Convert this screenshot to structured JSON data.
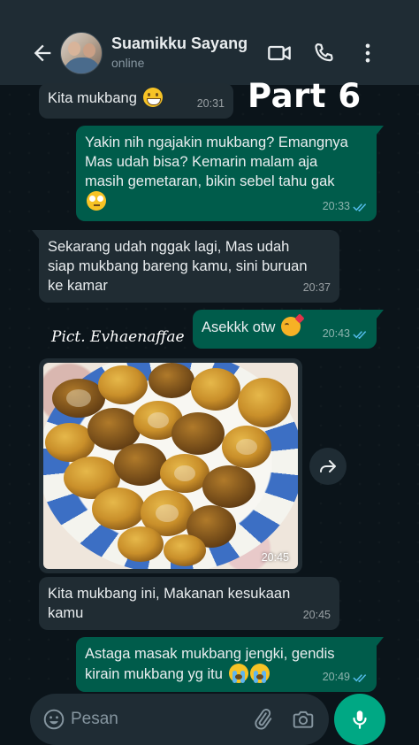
{
  "header": {
    "contact_name": "Suamikku Sayang",
    "status": "online",
    "icons": [
      "back-arrow-icon",
      "video-call-icon",
      "phone-icon",
      "more-vert-icon"
    ]
  },
  "overlay": {
    "part_label": "Part 6",
    "watermark": "Pict. Evhaenaffae"
  },
  "messages": [
    {
      "direction": "in",
      "text": "Kita mukbang",
      "emoji": "grinning-face",
      "time": "20:31"
    },
    {
      "direction": "out",
      "text": "Yakin nih ngajakin mukbang? Emangnya Mas udah bisa? Kemarin malam aja masih gemetaran, bikin sebel tahu gak",
      "emoji": "rolling-eyes",
      "time": "20:33",
      "status": "read"
    },
    {
      "direction": "in",
      "text": "Sekarang udah nggak lagi, Mas udah siap mukbang bareng kamu, sini buruan ke kamar",
      "time": "20:37"
    },
    {
      "direction": "out",
      "text": "Asekkk otw",
      "emoji": "smiling-face-with-hearts",
      "time": "20:43",
      "status": "read"
    },
    {
      "direction": "in",
      "type": "image",
      "time": "20:45"
    },
    {
      "direction": "in",
      "text": "Kita mukbang ini, Makanan kesukaan kamu",
      "time": "20:45"
    },
    {
      "direction": "out",
      "text": "Astaga masak mukbang jengki, gendis kirain mukbang yg itu",
      "emoji": "loudly-crying-face",
      "time": "20:49",
      "status": "read"
    }
  ],
  "composer": {
    "placeholder": "Pesan"
  },
  "colors": {
    "background": "#0b141a",
    "header": "#1f2c34",
    "incoming_bubble": "#202c33",
    "outgoing_bubble": "#005c4b",
    "accent": "#00a884",
    "read_tick": "#53bdeb"
  }
}
